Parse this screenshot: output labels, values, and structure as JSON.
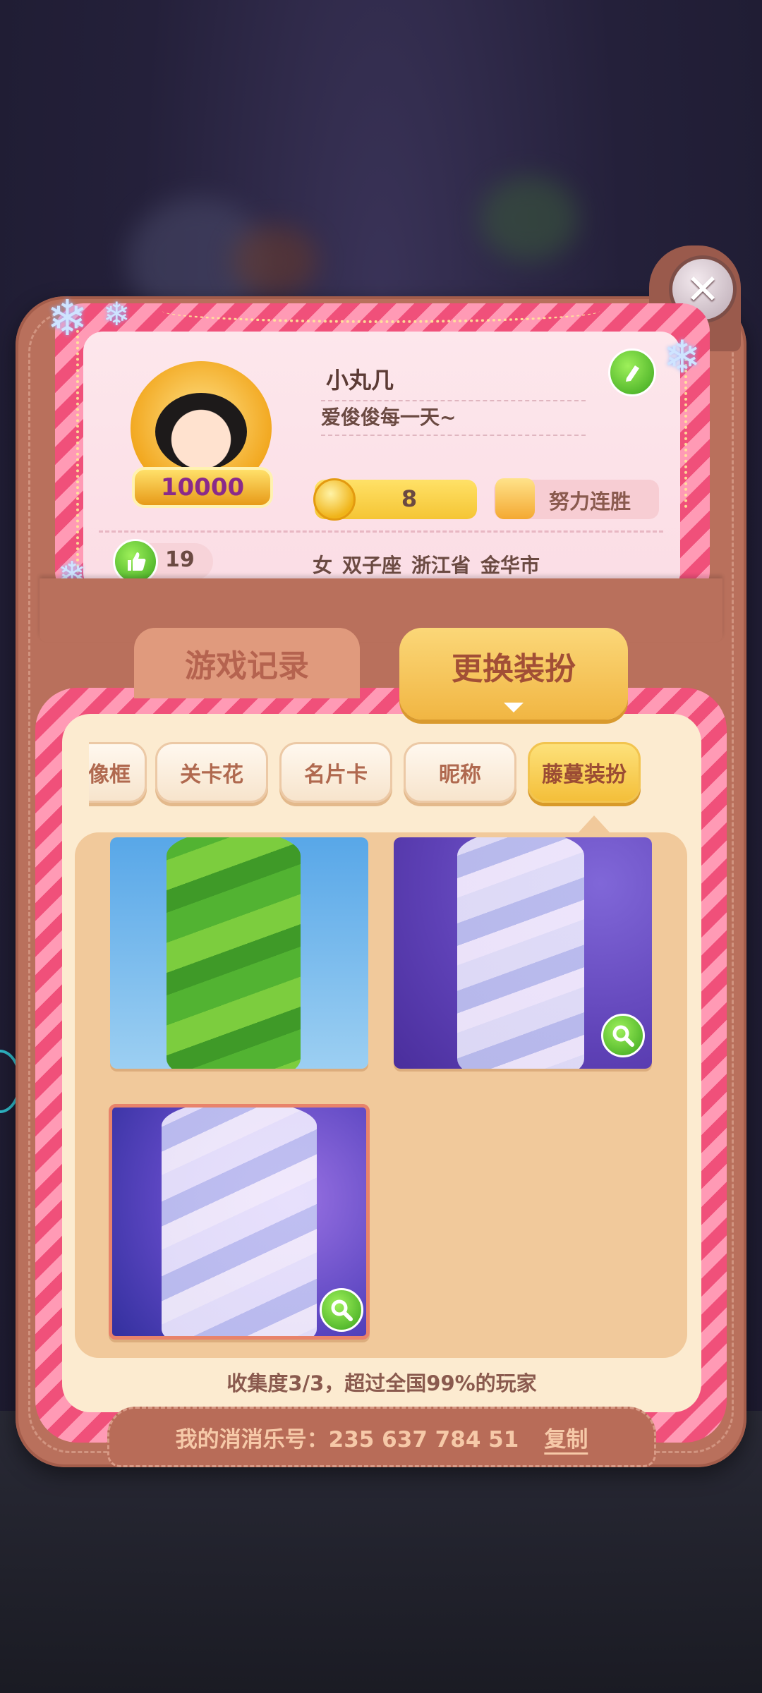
{
  "close": {
    "glyph": "✕"
  },
  "profile": {
    "avatar_badge": "10000",
    "name": "小丸几",
    "signature": "爱俊俊每一天~",
    "coins": "8",
    "streak_label": "努力连胜",
    "likes": "19",
    "info": [
      "女",
      "双子座",
      "浙江省",
      "金华市"
    ]
  },
  "tabs": {
    "left": "游戏记录",
    "right": "更换装扮"
  },
  "chips": [
    "像框",
    "关卡花",
    "名片卡",
    "昵称",
    "藤蔓装扮"
  ],
  "active_chip": "藤蔓装扮",
  "items": [
    {
      "name": "green-vine",
      "zoom": false,
      "selected": false
    },
    {
      "name": "crystal-vine",
      "zoom": true,
      "selected": false
    },
    {
      "name": "crystal-heart-vine",
      "zoom": true,
      "selected": true
    }
  ],
  "collection_text": "收集度3/3，超过全国99%的玩家",
  "footer": {
    "id_text": "我的消消乐号：235 637 784 51",
    "copy_label": "复制"
  },
  "colors": {
    "accent_pink": "#f0507a",
    "gold": "#f4bf3a",
    "leather": "#b9705c"
  },
  "icons": [
    "close-icon",
    "edit-icon",
    "coin-icon",
    "like-icon",
    "zoom-icon",
    "snowflake-icon"
  ]
}
